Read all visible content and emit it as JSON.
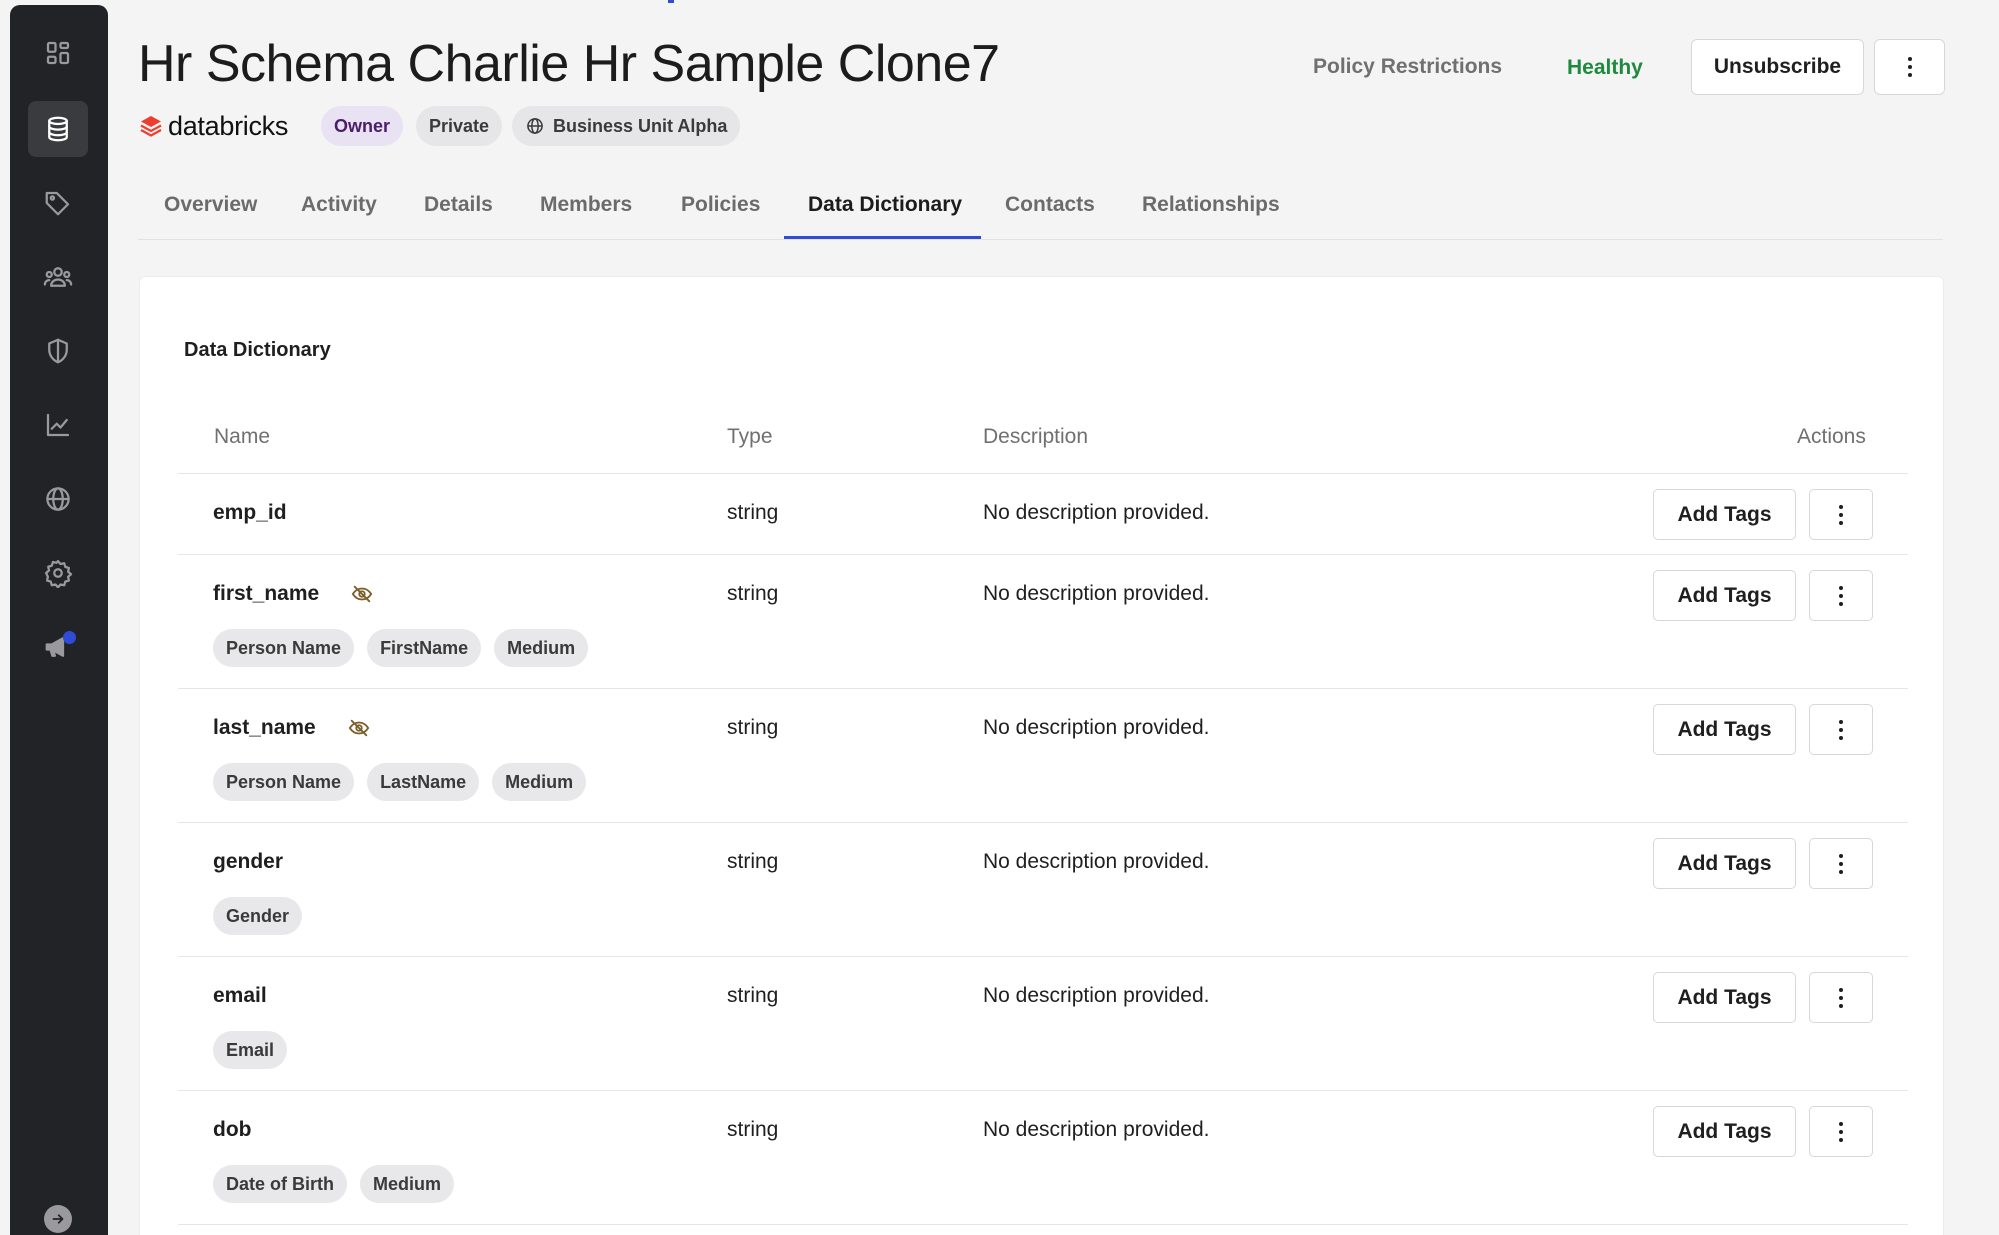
{
  "sidebar": {
    "items": [
      {
        "icon": "dashboard-icon",
        "active": false
      },
      {
        "icon": "database-icon",
        "active": true
      },
      {
        "icon": "tags-icon",
        "active": false
      },
      {
        "icon": "users-icon",
        "active": false
      },
      {
        "icon": "shield-icon",
        "active": false
      },
      {
        "icon": "chart-line-icon",
        "active": false
      },
      {
        "icon": "globe-icon",
        "active": false
      },
      {
        "icon": "gear-icon",
        "active": false
      },
      {
        "icon": "megaphone-icon",
        "active": false,
        "has_notification": true
      }
    ],
    "collapse_icon": "arrow-right-circle-icon"
  },
  "header": {
    "title": "Hr Schema Charlie Hr Sample Clone7",
    "brand": "databricks",
    "badges": {
      "owner": "Owner",
      "private": "Private",
      "business_unit": "Business Unit Alpha"
    },
    "policy_link": "Policy Restrictions",
    "health": "Healthy",
    "unsubscribe_label": "Unsubscribe",
    "health_color": "#1e8a3e",
    "accent_color": "#2f4bd8"
  },
  "tabs": [
    {
      "label": "Overview"
    },
    {
      "label": "Activity"
    },
    {
      "label": "Details"
    },
    {
      "label": "Members"
    },
    {
      "label": "Policies"
    },
    {
      "label": "Data Dictionary",
      "active": true
    },
    {
      "label": "Contacts"
    },
    {
      "label": "Relationships"
    }
  ],
  "dictionary": {
    "title": "Data Dictionary",
    "columns": {
      "name": "Name",
      "type": "Type",
      "description": "Description",
      "actions": "Actions"
    },
    "add_tags_label": "Add Tags",
    "rows": [
      {
        "name": "emp_id",
        "type": "string",
        "description": "No description provided.",
        "masked": false,
        "tags": []
      },
      {
        "name": "first_name",
        "type": "string",
        "description": "No description provided.",
        "masked": true,
        "tags": [
          "Person Name",
          "FirstName",
          "Medium"
        ]
      },
      {
        "name": "last_name",
        "type": "string",
        "description": "No description provided.",
        "masked": true,
        "tags": [
          "Person Name",
          "LastName",
          "Medium"
        ]
      },
      {
        "name": "gender",
        "type": "string",
        "description": "No description provided.",
        "masked": false,
        "tags": [
          "Gender"
        ]
      },
      {
        "name": "email",
        "type": "string",
        "description": "No description provided.",
        "masked": false,
        "tags": [
          "Email"
        ]
      },
      {
        "name": "dob",
        "type": "string",
        "description": "No description provided.",
        "masked": false,
        "tags": [
          "Date of Birth",
          "Medium"
        ]
      }
    ]
  }
}
